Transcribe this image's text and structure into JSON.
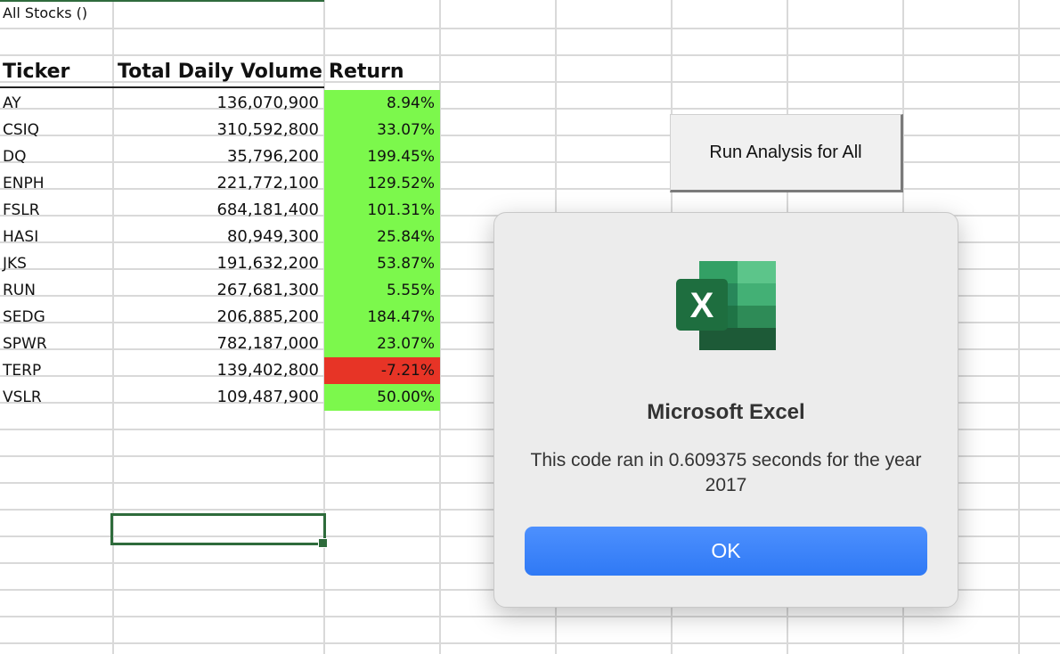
{
  "sheet": {
    "title_cell": "All Stocks ()",
    "headers": {
      "ticker": "Ticker",
      "volume": "Total Daily Volume",
      "return": "Return"
    },
    "rows": [
      {
        "ticker": "AY",
        "volume": "136,070,900",
        "return": "8.94%",
        "status": "positive"
      },
      {
        "ticker": "CSIQ",
        "volume": "310,592,800",
        "return": "33.07%",
        "status": "positive"
      },
      {
        "ticker": "DQ",
        "volume": "35,796,200",
        "return": "199.45%",
        "status": "positive"
      },
      {
        "ticker": "ENPH",
        "volume": "221,772,100",
        "return": "129.52%",
        "status": "positive"
      },
      {
        "ticker": "FSLR",
        "volume": "684,181,400",
        "return": "101.31%",
        "status": "positive"
      },
      {
        "ticker": "HASI",
        "volume": "80,949,300",
        "return": "25.84%",
        "status": "positive"
      },
      {
        "ticker": "JKS",
        "volume": "191,632,200",
        "return": "53.87%",
        "status": "positive"
      },
      {
        "ticker": "RUN",
        "volume": "267,681,300",
        "return": "5.55%",
        "status": "positive"
      },
      {
        "ticker": "SEDG",
        "volume": "206,885,200",
        "return": "184.47%",
        "status": "positive"
      },
      {
        "ticker": "SPWR",
        "volume": "782,187,000",
        "return": "23.07%",
        "status": "positive"
      },
      {
        "ticker": "TERP",
        "volume": "139,402,800",
        "return": "-7.21%",
        "status": "negative"
      },
      {
        "ticker": "VSLR",
        "volume": "109,487,900",
        "return": "50.00%",
        "status": "positive"
      }
    ],
    "colors": {
      "positive": "#7cf84c",
      "negative": "#e73426",
      "selection": "#2e6b3b"
    }
  },
  "run_button": {
    "label": "Run Analysis for All"
  },
  "dialog": {
    "app_icon": "excel-app-icon",
    "icon_letter": "X",
    "title": "Microsoft Excel",
    "message": "This code ran in 0.609375 seconds for the year 2017",
    "ok_label": "OK",
    "accent": "#3b82f6"
  }
}
